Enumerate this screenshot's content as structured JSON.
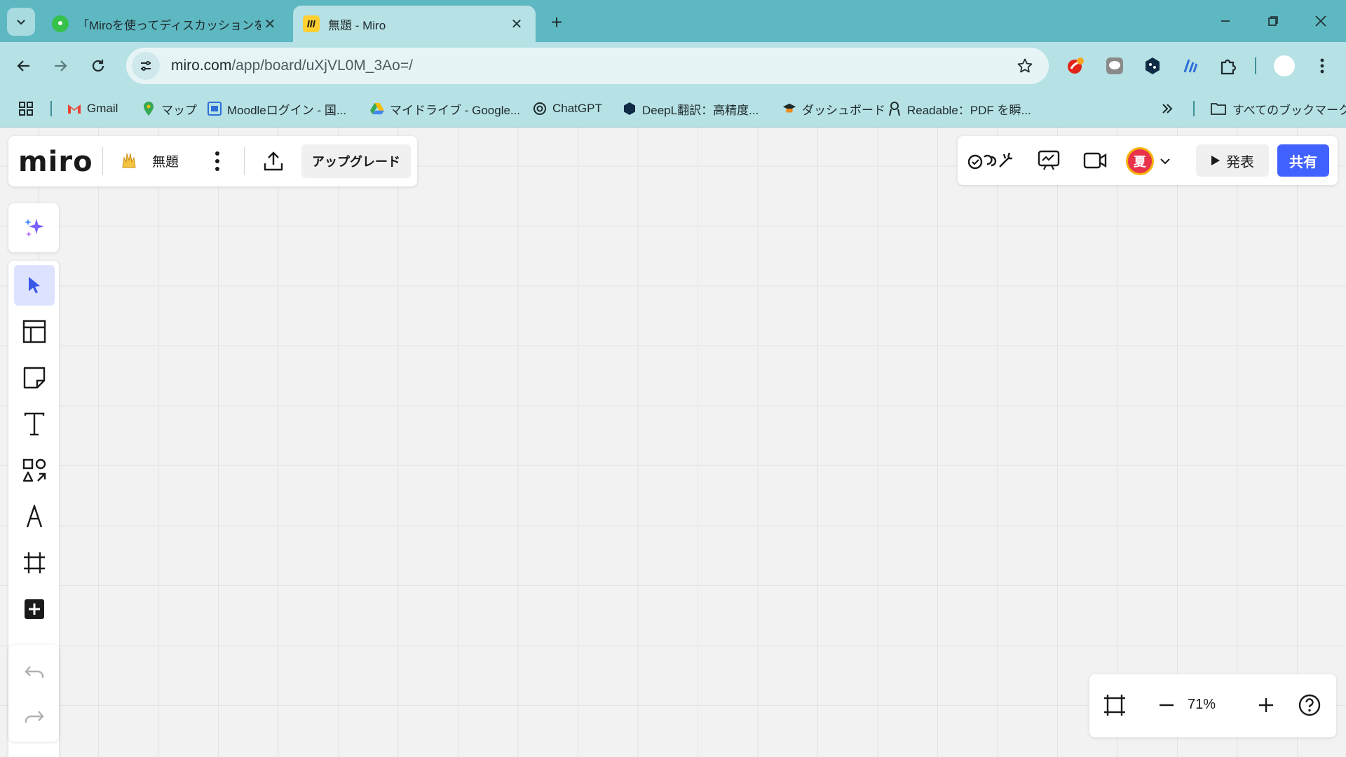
{
  "browser": {
    "tabs": [
      {
        "title": "「Miroを使ってディスカッションをオン",
        "active": false
      },
      {
        "title": "無題 - Miro",
        "active": true
      }
    ],
    "url": {
      "host": "miro.com",
      "path": "/app/board/uXjVL0M_3Ao=/"
    },
    "bookmarks": [
      {
        "label": "Gmail",
        "icon": "gmail-icon"
      },
      {
        "label": "マップ",
        "icon": "maps-pin-icon"
      },
      {
        "label": "Moodleログイン - 国...",
        "icon": "moodle-icon"
      },
      {
        "label": "マイドライブ - Google...",
        "icon": "drive-icon"
      },
      {
        "label": "ChatGPT",
        "icon": "chatgpt-icon"
      },
      {
        "label": "DeepL翻訳：高精度...",
        "icon": "deepl-icon"
      },
      {
        "label": "ダッシュボード",
        "icon": "dashboard-icon"
      },
      {
        "label": "Readable：PDF を瞬...",
        "icon": "readable-icon"
      }
    ],
    "all_bookmarks_label": "すべてのブックマーク"
  },
  "miro": {
    "logo": "miro",
    "board_name": "無題",
    "upgrade_label": "アップグレード",
    "avatar_initial": "夏",
    "present_label": "発表",
    "share_label": "共有",
    "zoom": "71%"
  },
  "colors": {
    "chrome_teal": "#5eb8c2",
    "share_blue": "#4262ff",
    "selected_tool": "#dde3ff",
    "avatar_red": "#e8334a"
  }
}
